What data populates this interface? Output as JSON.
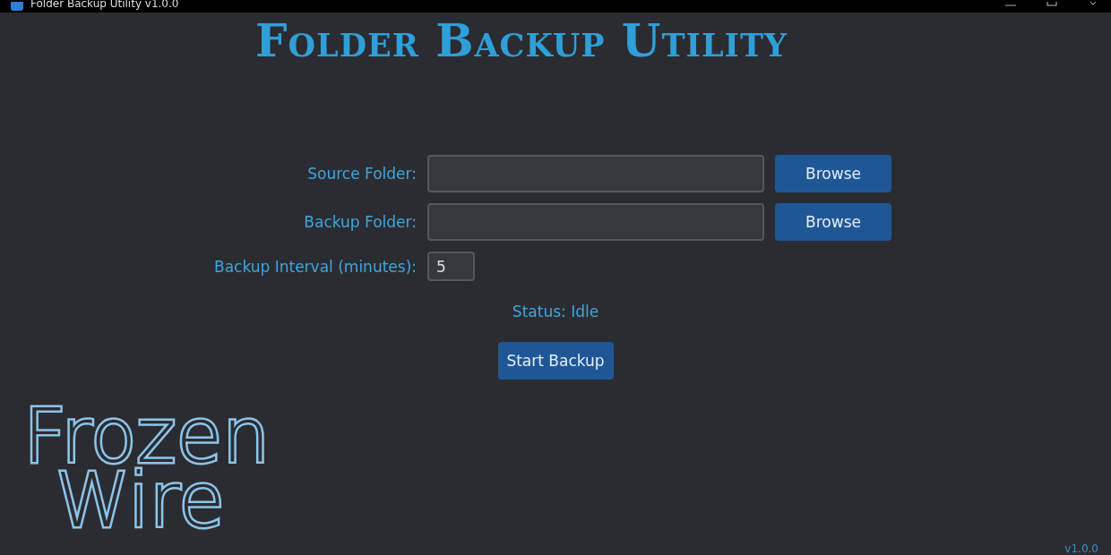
{
  "window": {
    "title": "Folder Backup Utility v1.0.0"
  },
  "heading": "Folder Backup Utility",
  "fields": [
    {
      "label": "Source Folder:",
      "kind": "path",
      "button": "Browse"
    },
    {
      "label": "Backup Folder:",
      "kind": "path",
      "button": "Browse"
    },
    {
      "label": "Backup Interval (minutes):",
      "kind": "number",
      "value": "5"
    }
  ],
  "status": "Status: Idle",
  "action_button": "Start Backup",
  "logo": {
    "lines": [
      "Frozen",
      "Wire"
    ]
  },
  "version": "v1.0.0"
}
